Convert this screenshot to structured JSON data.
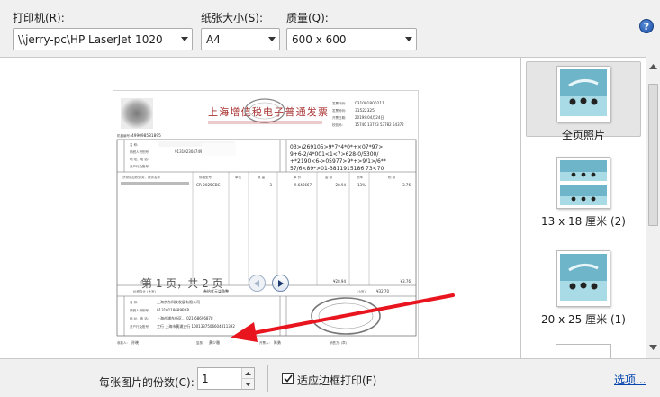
{
  "printer": {
    "label": "打印机(R):",
    "value": "\\\\jerry-pc\\HP LaserJet 1020"
  },
  "paper": {
    "label": "纸张大小(S):",
    "value": "A4"
  },
  "quality": {
    "label": "质量(Q):",
    "value": "600 x 600"
  },
  "help": {
    "glyph": "?"
  },
  "invoice": {
    "title": "上海增值税电子普通发票",
    "code_lines": [
      "03>/269105>9*7*4*0*+×07*97>",
      "9+6-2/4*001<1<7>628-0/5300/",
      "+*2190<6->05977>9*+>9/1>/6**",
      "57/6<89*>01-3811915186 73<70"
    ],
    "code_number": "031001800211",
    "invoice_number": "31522325",
    "issue_date": "2019年04月24日",
    "check_code": "15740 13723 53782 54372",
    "machine_number": "499098581895",
    "buyer_tax_id": "91310230474953676L",
    "item_code": "CR-2025CBC",
    "quantity": "3",
    "unit_price": "9.646667",
    "amount": "28.94",
    "tax_rate": "13%",
    "tax": "3.76",
    "amount_total": "¥28.94",
    "tax_total": "¥3.76",
    "grand_total_cn": "叁拾贰元柒角整",
    "grand_total": "¥32.70",
    "seller_name": "上海京东科技发展有限公司",
    "seller_tax_id": "91310118689BXP",
    "seller_address": "上海市浦东新区... 021-68696878",
    "seller_bank": "工行 上海市黄浦支行 1001337506604811392",
    "payee": "孙晓",
    "reviewer": "黄少雅",
    "issuer": "陈勇"
  },
  "pager": {
    "text": "第 1 页，共 2 页"
  },
  "layouts": [
    {
      "label": "全页照片"
    },
    {
      "label": "13 x 18 厘米 (2)"
    },
    {
      "label": "20 x 25 厘米 (1)"
    }
  ],
  "bottom": {
    "copies_label": "每张图片的份数(C):",
    "copies_value": "1",
    "fit_label": "适应边框打印(F)",
    "fit_checked": true,
    "options_label": "选项..."
  },
  "colors": {
    "accent": "#0645ad",
    "arrow": "#e8141e",
    "selected_bg": "#e5e5e5"
  }
}
